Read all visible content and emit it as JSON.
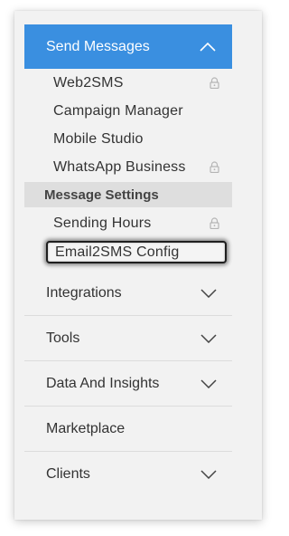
{
  "menu": {
    "send_messages": {
      "label": "Send Messages",
      "expanded_icon": "chevron-up-icon"
    },
    "sub_items": [
      {
        "label": "Web2SMS",
        "locked": true
      },
      {
        "label": "Campaign Manager",
        "locked": false
      },
      {
        "label": "Mobile Studio",
        "locked": false
      },
      {
        "label": "WhatsApp Business",
        "locked": true
      }
    ],
    "message_settings": {
      "label": "Message Settings",
      "items": [
        {
          "label": "Sending Hours",
          "locked": true
        },
        {
          "label": "Email2SMS Config",
          "locked": false,
          "highlighted": true
        }
      ]
    },
    "main_items": [
      {
        "label": "Integrations",
        "has_chevron": true
      },
      {
        "label": "Tools",
        "has_chevron": true
      },
      {
        "label": "Data And Insights",
        "has_chevron": true
      },
      {
        "label": "Marketplace",
        "has_chevron": false
      },
      {
        "label": "Clients",
        "has_chevron": true
      }
    ]
  },
  "colors": {
    "accent": "#3a8fe0",
    "panel_bg": "#f2f2f2",
    "group_bg": "#dedede",
    "text": "#333333"
  }
}
